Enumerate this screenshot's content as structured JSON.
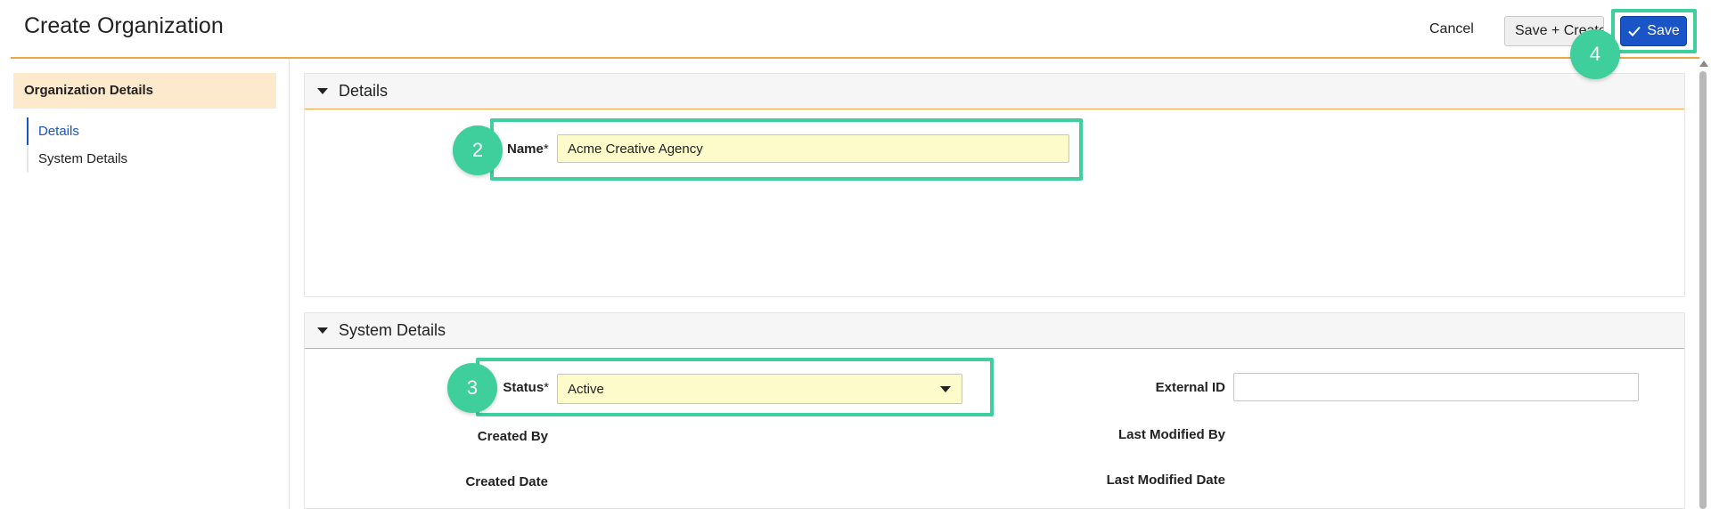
{
  "header": {
    "title": "Create Organization",
    "cancel_label": "Cancel",
    "save_create_label": "Save + Create",
    "save_label": "Save"
  },
  "sidebar": {
    "header": "Organization Details",
    "items": [
      {
        "label": "Details",
        "active": true
      },
      {
        "label": "System Details",
        "active": false
      }
    ]
  },
  "details": {
    "title": "Details",
    "name_label": "Name",
    "name_required": "*",
    "name_value": "Acme Creative Agency"
  },
  "system_details": {
    "title": "System Details",
    "status_label": "Status",
    "status_required": "*",
    "status_value": "Active",
    "external_id_label": "External ID",
    "external_id_value": "",
    "created_by_label": "Created By",
    "created_date_label": "Created Date",
    "last_modified_by_label": "Last Modified By",
    "last_modified_date_label": "Last Modified Date"
  },
  "annotations": {
    "name_step": "2",
    "status_step": "3",
    "save_step": "4",
    "highlight_color": "#3fcf9c"
  },
  "colors": {
    "accent": "#f0a647",
    "primary": "#1a55c8",
    "required_field": "#fefbcb"
  }
}
